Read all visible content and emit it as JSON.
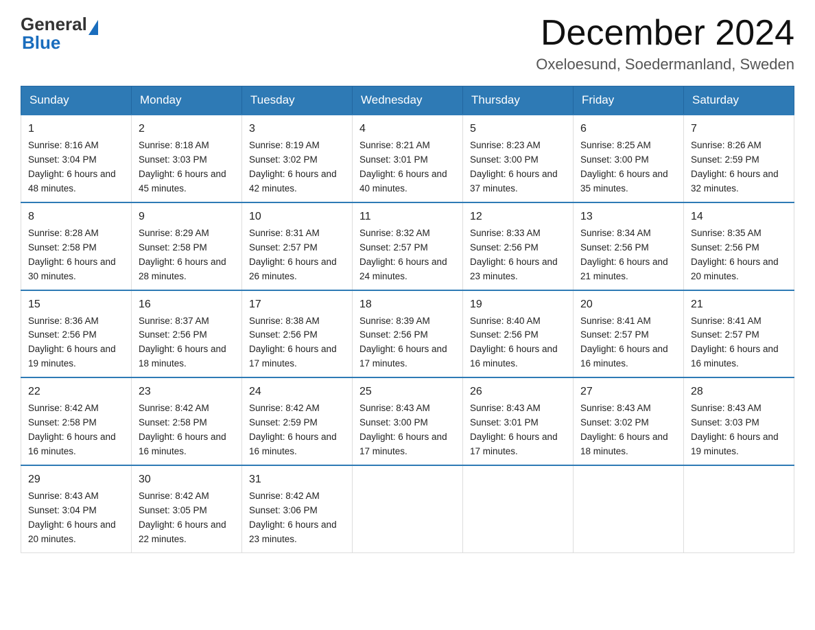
{
  "header": {
    "logo_general": "General",
    "logo_blue": "Blue",
    "month_title": "December 2024",
    "location": "Oxeloesund, Soedermanland, Sweden"
  },
  "days_of_week": [
    "Sunday",
    "Monday",
    "Tuesday",
    "Wednesday",
    "Thursday",
    "Friday",
    "Saturday"
  ],
  "weeks": [
    [
      {
        "day": "1",
        "sunrise": "8:16 AM",
        "sunset": "3:04 PM",
        "daylight": "6 hours and 48 minutes."
      },
      {
        "day": "2",
        "sunrise": "8:18 AM",
        "sunset": "3:03 PM",
        "daylight": "6 hours and 45 minutes."
      },
      {
        "day": "3",
        "sunrise": "8:19 AM",
        "sunset": "3:02 PM",
        "daylight": "6 hours and 42 minutes."
      },
      {
        "day": "4",
        "sunrise": "8:21 AM",
        "sunset": "3:01 PM",
        "daylight": "6 hours and 40 minutes."
      },
      {
        "day": "5",
        "sunrise": "8:23 AM",
        "sunset": "3:00 PM",
        "daylight": "6 hours and 37 minutes."
      },
      {
        "day": "6",
        "sunrise": "8:25 AM",
        "sunset": "3:00 PM",
        "daylight": "6 hours and 35 minutes."
      },
      {
        "day": "7",
        "sunrise": "8:26 AM",
        "sunset": "2:59 PM",
        "daylight": "6 hours and 32 minutes."
      }
    ],
    [
      {
        "day": "8",
        "sunrise": "8:28 AM",
        "sunset": "2:58 PM",
        "daylight": "6 hours and 30 minutes."
      },
      {
        "day": "9",
        "sunrise": "8:29 AM",
        "sunset": "2:58 PM",
        "daylight": "6 hours and 28 minutes."
      },
      {
        "day": "10",
        "sunrise": "8:31 AM",
        "sunset": "2:57 PM",
        "daylight": "6 hours and 26 minutes."
      },
      {
        "day": "11",
        "sunrise": "8:32 AM",
        "sunset": "2:57 PM",
        "daylight": "6 hours and 24 minutes."
      },
      {
        "day": "12",
        "sunrise": "8:33 AM",
        "sunset": "2:56 PM",
        "daylight": "6 hours and 23 minutes."
      },
      {
        "day": "13",
        "sunrise": "8:34 AM",
        "sunset": "2:56 PM",
        "daylight": "6 hours and 21 minutes."
      },
      {
        "day": "14",
        "sunrise": "8:35 AM",
        "sunset": "2:56 PM",
        "daylight": "6 hours and 20 minutes."
      }
    ],
    [
      {
        "day": "15",
        "sunrise": "8:36 AM",
        "sunset": "2:56 PM",
        "daylight": "6 hours and 19 minutes."
      },
      {
        "day": "16",
        "sunrise": "8:37 AM",
        "sunset": "2:56 PM",
        "daylight": "6 hours and 18 minutes."
      },
      {
        "day": "17",
        "sunrise": "8:38 AM",
        "sunset": "2:56 PM",
        "daylight": "6 hours and 17 minutes."
      },
      {
        "day": "18",
        "sunrise": "8:39 AM",
        "sunset": "2:56 PM",
        "daylight": "6 hours and 17 minutes."
      },
      {
        "day": "19",
        "sunrise": "8:40 AM",
        "sunset": "2:56 PM",
        "daylight": "6 hours and 16 minutes."
      },
      {
        "day": "20",
        "sunrise": "8:41 AM",
        "sunset": "2:57 PM",
        "daylight": "6 hours and 16 minutes."
      },
      {
        "day": "21",
        "sunrise": "8:41 AM",
        "sunset": "2:57 PM",
        "daylight": "6 hours and 16 minutes."
      }
    ],
    [
      {
        "day": "22",
        "sunrise": "8:42 AM",
        "sunset": "2:58 PM",
        "daylight": "6 hours and 16 minutes."
      },
      {
        "day": "23",
        "sunrise": "8:42 AM",
        "sunset": "2:58 PM",
        "daylight": "6 hours and 16 minutes."
      },
      {
        "day": "24",
        "sunrise": "8:42 AM",
        "sunset": "2:59 PM",
        "daylight": "6 hours and 16 minutes."
      },
      {
        "day": "25",
        "sunrise": "8:43 AM",
        "sunset": "3:00 PM",
        "daylight": "6 hours and 17 minutes."
      },
      {
        "day": "26",
        "sunrise": "8:43 AM",
        "sunset": "3:01 PM",
        "daylight": "6 hours and 17 minutes."
      },
      {
        "day": "27",
        "sunrise": "8:43 AM",
        "sunset": "3:02 PM",
        "daylight": "6 hours and 18 minutes."
      },
      {
        "day": "28",
        "sunrise": "8:43 AM",
        "sunset": "3:03 PM",
        "daylight": "6 hours and 19 minutes."
      }
    ],
    [
      {
        "day": "29",
        "sunrise": "8:43 AM",
        "sunset": "3:04 PM",
        "daylight": "6 hours and 20 minutes."
      },
      {
        "day": "30",
        "sunrise": "8:42 AM",
        "sunset": "3:05 PM",
        "daylight": "6 hours and 22 minutes."
      },
      {
        "day": "31",
        "sunrise": "8:42 AM",
        "sunset": "3:06 PM",
        "daylight": "6 hours and 23 minutes."
      },
      null,
      null,
      null,
      null
    ]
  ]
}
